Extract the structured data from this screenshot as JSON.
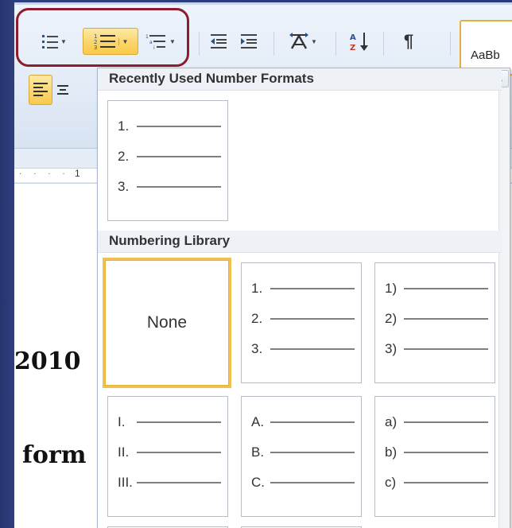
{
  "document": {
    "text_year": "2010",
    "text_form": "form"
  },
  "ribbon": {
    "style_preview": "AaBb",
    "buttons": {
      "bullets": "bullets-icon",
      "numbering": "numbering-icon",
      "multilevel": "multilevel-list-icon",
      "decrease_indent": "decrease-indent-icon",
      "increase_indent": "increase-indent-icon",
      "sort": "sort-icon",
      "show_marks": "pilcrow-icon"
    },
    "ruler_mark": "1"
  },
  "gallery": {
    "recent_header": "Recently Used Number Formats",
    "library_header": "Numbering Library",
    "recent": [
      {
        "lines": [
          "1.",
          "2.",
          "3."
        ]
      }
    ],
    "library": [
      {
        "type": "none",
        "label": "None",
        "selected": true
      },
      {
        "lines": [
          "1.",
          "2.",
          "3."
        ]
      },
      {
        "lines": [
          "1)",
          "2)",
          "3)"
        ]
      },
      {
        "lines": [
          "I.",
          "II.",
          "III."
        ]
      },
      {
        "lines": [
          "A.",
          "B.",
          "C."
        ]
      },
      {
        "lines": [
          "a)",
          "b)",
          "c)"
        ]
      }
    ]
  },
  "colors": {
    "highlight_oval": "#8c1d2c",
    "active_button": "#f9c94a",
    "slide_background": "#2a3a78"
  }
}
